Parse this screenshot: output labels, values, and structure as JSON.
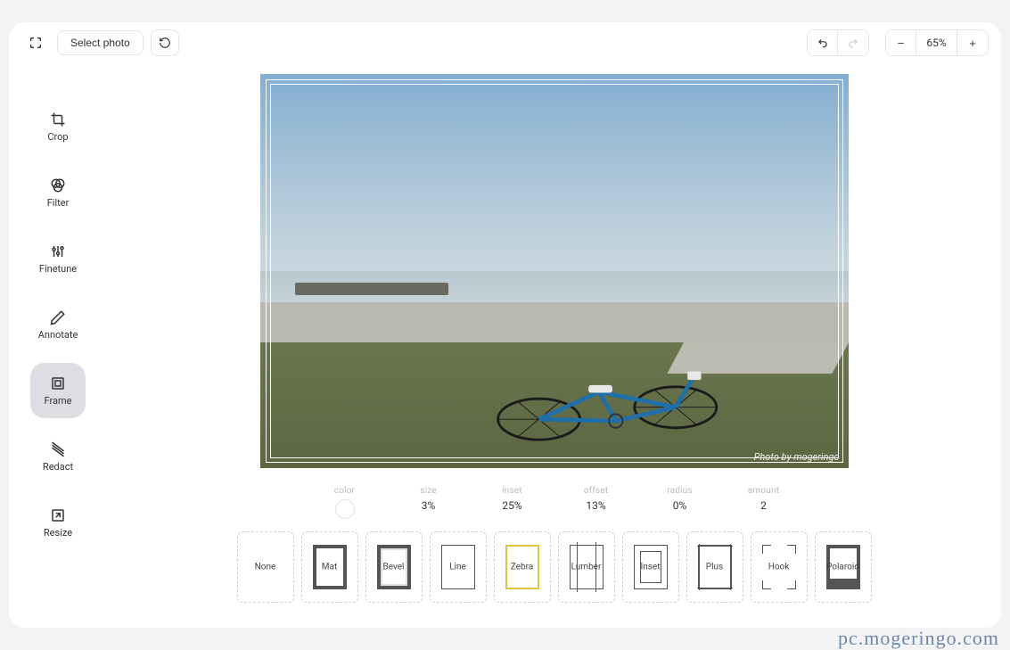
{
  "topbar": {
    "select_photo_label": "Select photo",
    "zoom_level": "65%"
  },
  "sidebar": {
    "tools": [
      {
        "id": "crop",
        "label": "Crop",
        "active": false
      },
      {
        "id": "filter",
        "label": "Filter",
        "active": false
      },
      {
        "id": "finetune",
        "label": "Finetune",
        "active": false
      },
      {
        "id": "annotate",
        "label": "Annotate",
        "active": false
      },
      {
        "id": "frame",
        "label": "Frame",
        "active": true
      },
      {
        "id": "redact",
        "label": "Redact",
        "active": false
      },
      {
        "id": "resize",
        "label": "Resize",
        "active": false
      }
    ]
  },
  "canvas": {
    "photo_watermark": "Photo by mogeringo"
  },
  "frame_params": {
    "color": {
      "label": "color",
      "value_hex": "#ffffff"
    },
    "size": {
      "label": "size",
      "value": "3%"
    },
    "inset": {
      "label": "inset",
      "value": "25%"
    },
    "offset": {
      "label": "offset",
      "value": "13%"
    },
    "radius": {
      "label": "radius",
      "value": "0%"
    },
    "amount": {
      "label": "amount",
      "value": "2"
    }
  },
  "frame_styles": [
    {
      "id": "none",
      "label": "None"
    },
    {
      "id": "mat",
      "label": "Mat"
    },
    {
      "id": "bevel",
      "label": "Bevel"
    },
    {
      "id": "line",
      "label": "Line"
    },
    {
      "id": "zebra",
      "label": "Zebra"
    },
    {
      "id": "lumber",
      "label": "Lumber"
    },
    {
      "id": "inset",
      "label": "Inset"
    },
    {
      "id": "plus",
      "label": "Plus"
    },
    {
      "id": "hook",
      "label": "Hook"
    },
    {
      "id": "polaroid",
      "label": "Polaroid"
    }
  ],
  "site_watermark": "pc.mogeringo.com"
}
